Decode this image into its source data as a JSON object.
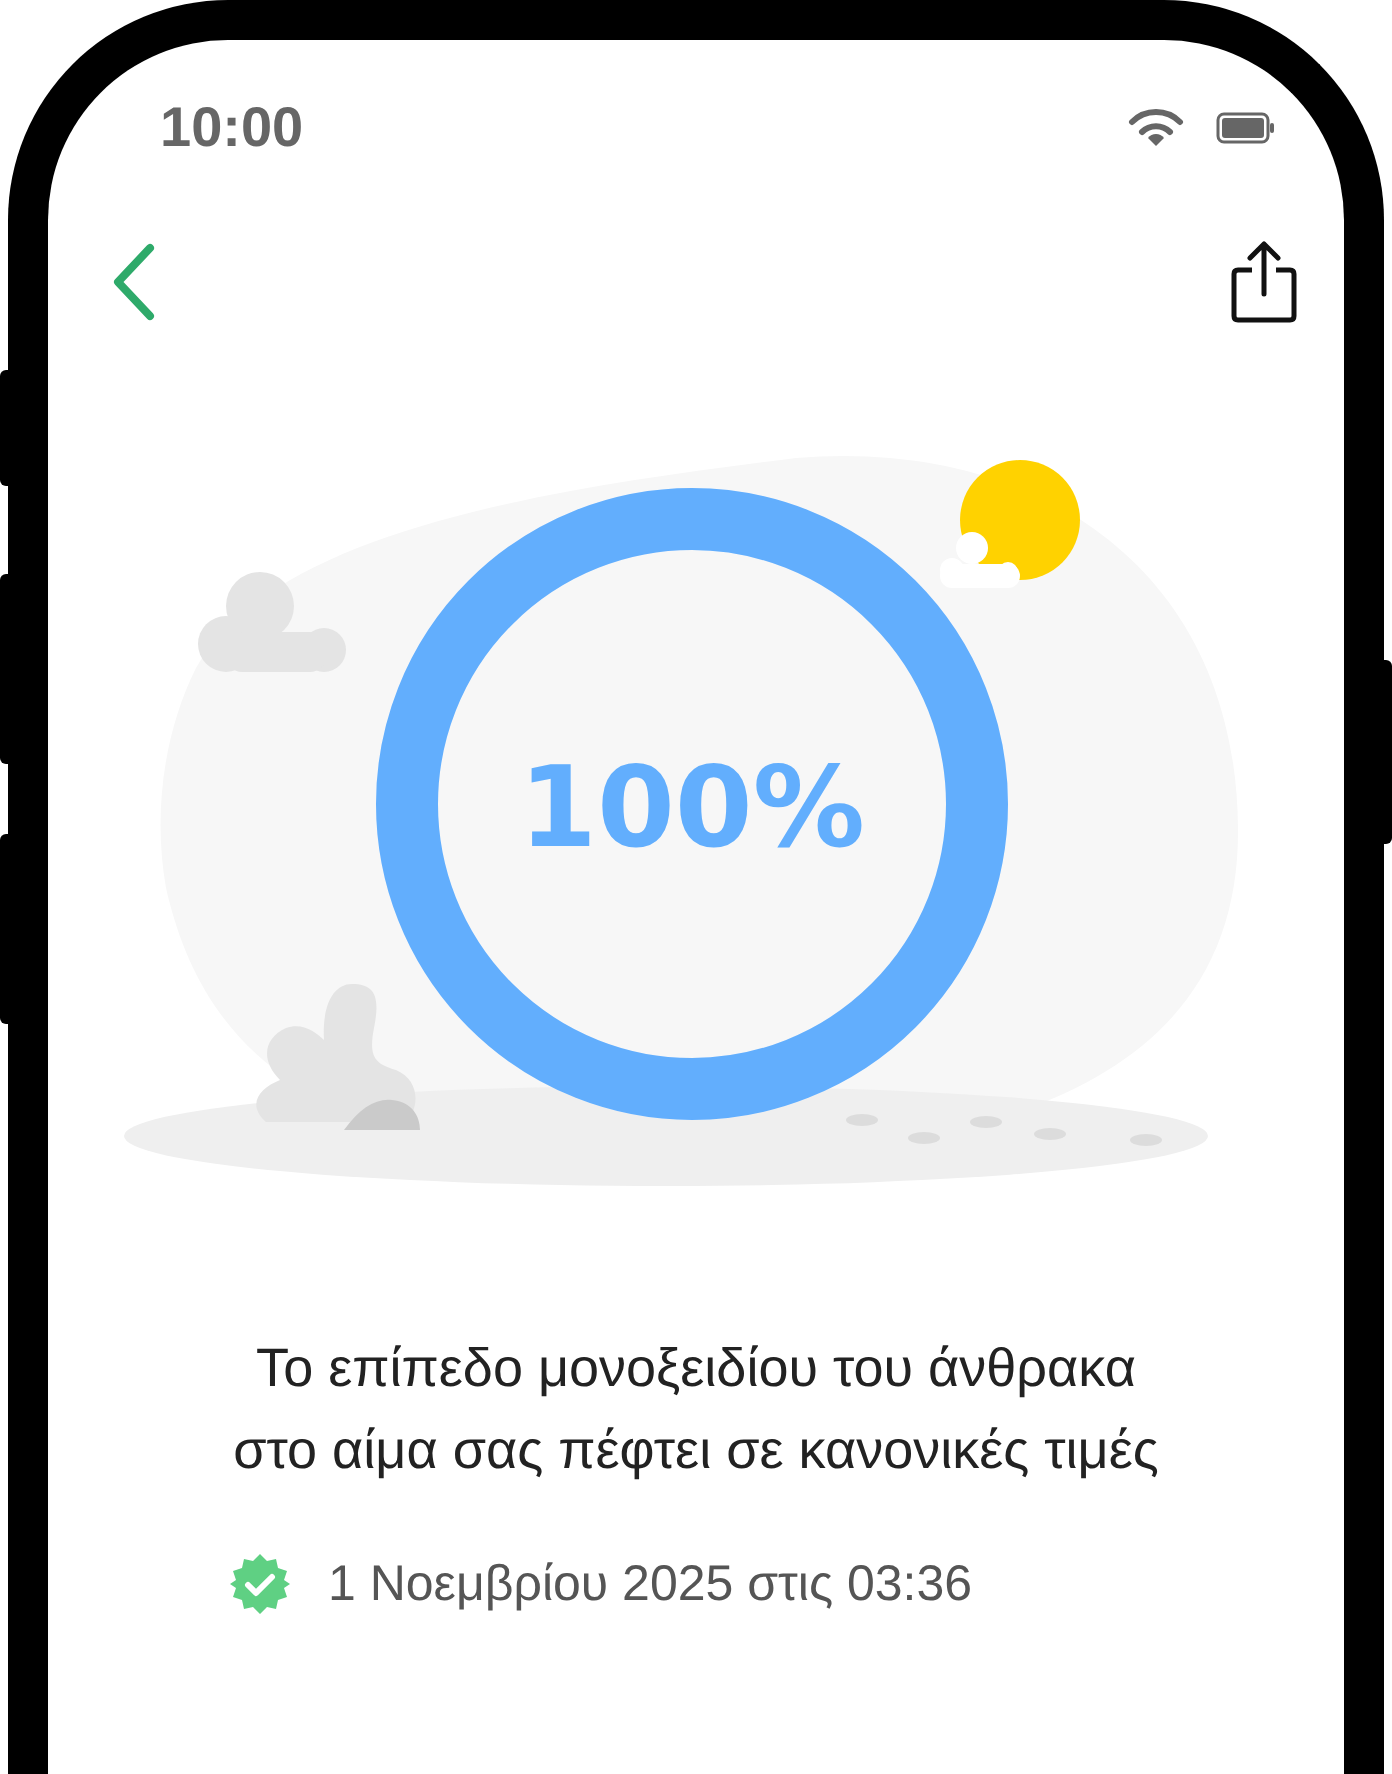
{
  "status_bar": {
    "time": "10:00"
  },
  "result": {
    "percent": "100%",
    "level": 1
  },
  "message": "Το επίπεδο μονοξειδίου του άνθρακα στο αίμα σας πέφτει σε κανονικές τιμές",
  "timestamp": "1 Νοεμβρίου 2025 στις 03:36"
}
